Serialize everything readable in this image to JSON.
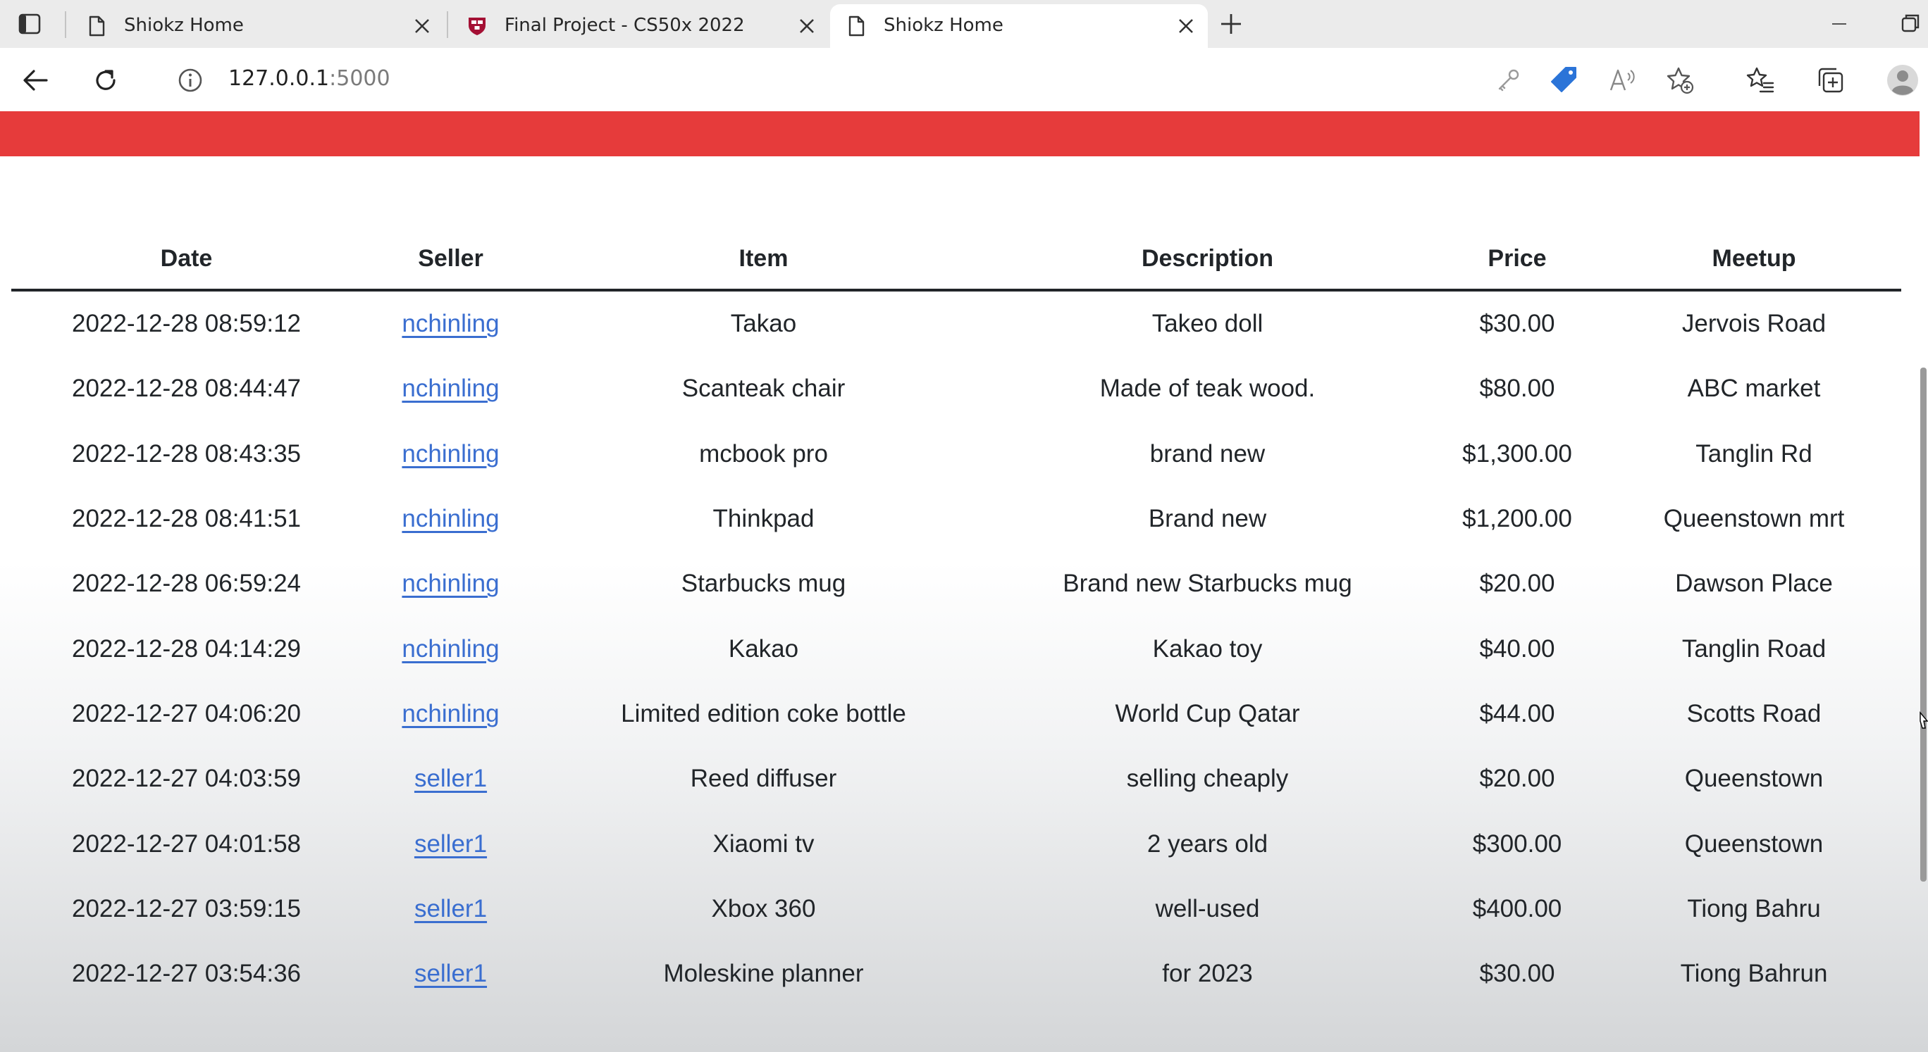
{
  "browser": {
    "tabs": [
      {
        "title": "Shiokz Home",
        "favicon": "page-icon",
        "active": false
      },
      {
        "title": "Final Project - CS50x 2022",
        "favicon": "harvard-shield-icon",
        "active": false
      },
      {
        "title": "Shiokz Home",
        "favicon": "page-icon",
        "active": true
      }
    ],
    "address": {
      "host": "127.0.0.1",
      "port": ":5000"
    }
  },
  "colors": {
    "navbar": "#e63b3b",
    "link": "#3a6ed0",
    "shield": "#a41034",
    "coupon_tag": "#2b74d8"
  },
  "table": {
    "headers": [
      "Date",
      "Seller",
      "Item",
      "Description",
      "Price",
      "Meetup"
    ],
    "rows": [
      [
        "2022-12-28 08:59:12",
        "nchinling",
        "Takao",
        "Takeo doll",
        "$30.00",
        "Jervois Road"
      ],
      [
        "2022-12-28 08:44:47",
        "nchinling",
        "Scanteak chair",
        "Made of teak wood.",
        "$80.00",
        "ABC market"
      ],
      [
        "2022-12-28 08:43:35",
        "nchinling",
        "mcbook pro",
        "brand new",
        "$1,300.00",
        "Tanglin Rd"
      ],
      [
        "2022-12-28 08:41:51",
        "nchinling",
        "Thinkpad",
        "Brand new",
        "$1,200.00",
        "Queenstown mrt"
      ],
      [
        "2022-12-28 06:59:24",
        "nchinling",
        "Starbucks mug",
        "Brand new Starbucks mug",
        "$20.00",
        "Dawson Place"
      ],
      [
        "2022-12-28 04:14:29",
        "nchinling",
        "Kakao",
        "Kakao toy",
        "$40.00",
        "Tanglin Road"
      ],
      [
        "2022-12-27 04:06:20",
        "nchinling",
        "Limited edition coke bottle",
        "World Cup Qatar",
        "$44.00",
        "Scotts Road"
      ],
      [
        "2022-12-27 04:03:59",
        "seller1",
        "Reed diffuser",
        "selling cheaply",
        "$20.00",
        "Queenstown"
      ],
      [
        "2022-12-27 04:01:58",
        "seller1",
        "Xiaomi tv",
        "2 years old",
        "$300.00",
        "Queenstown"
      ],
      [
        "2022-12-27 03:59:15",
        "seller1",
        "Xbox 360",
        "well-used",
        "$400.00",
        "Tiong Bahru"
      ],
      [
        "2022-12-27 03:54:36",
        "seller1",
        "Moleskine planner",
        "for 2023",
        "$30.00",
        "Tiong Bahrun"
      ]
    ]
  }
}
